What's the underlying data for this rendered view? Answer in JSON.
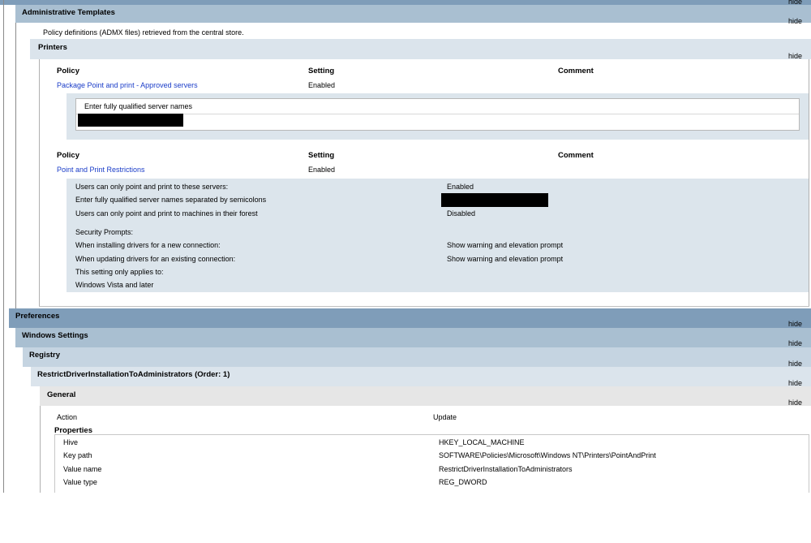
{
  "hide_label": "hide",
  "admin_templates": {
    "title": "Administrative Templates",
    "desc": "Policy definitions (ADMX files) retrieved from the central store."
  },
  "printers": {
    "title": "Printers",
    "table1": {
      "headers": [
        "Policy",
        "Setting",
        "Comment"
      ],
      "policy": "Package Point and print - Approved servers",
      "setting": "Enabled",
      "detail_label": "Enter fully qualified server names"
    },
    "table2": {
      "headers": [
        "Policy",
        "Setting",
        "Comment"
      ],
      "policy": "Point and Print Restrictions",
      "setting": "Enabled",
      "details": [
        {
          "label": "Users can only point and print to these servers:",
          "value": "Enabled"
        },
        {
          "label": "Enter fully qualified server names separated by semicolons",
          "value": ""
        },
        {
          "label": "Users can only point and print to machines in their forest",
          "value": "Disabled"
        },
        {
          "label": "Security Prompts:",
          "value": ""
        },
        {
          "label": "When installing drivers for a new connection:",
          "value": "Show warning and elevation prompt"
        },
        {
          "label": "When updating drivers for an existing connection:",
          "value": "Show warning and elevation prompt"
        },
        {
          "label": "This setting only applies to:",
          "value": ""
        },
        {
          "label": "Windows Vista and later",
          "value": ""
        }
      ]
    }
  },
  "preferences": {
    "title": "Preferences"
  },
  "windows_settings": {
    "title": "Windows Settings"
  },
  "registry": {
    "title": "Registry"
  },
  "registry_item": {
    "title": "RestrictDriverInstallationToAdministrators (Order: 1)"
  },
  "general": {
    "title": "General",
    "action_label": "Action",
    "action_value": "Update",
    "properties_label": "Properties",
    "properties": [
      {
        "label": "Hive",
        "value": "HKEY_LOCAL_MACHINE"
      },
      {
        "label": "Key path",
        "value": "SOFTWARE\\Policies\\Microsoft\\Windows NT\\Printers\\PointAndPrint"
      },
      {
        "label": "Value name",
        "value": "RestrictDriverInstallationToAdministrators"
      },
      {
        "label": "Value type",
        "value": "REG_DWORD"
      }
    ]
  },
  "colors": {
    "dark_header": "#7f9db9",
    "mid_header": "#a9bfd1",
    "light_header": "#dbe4ec",
    "detail_bg": "#dce5ec",
    "general_header": "#e6e6e6",
    "link": "#1a3cc8"
  }
}
